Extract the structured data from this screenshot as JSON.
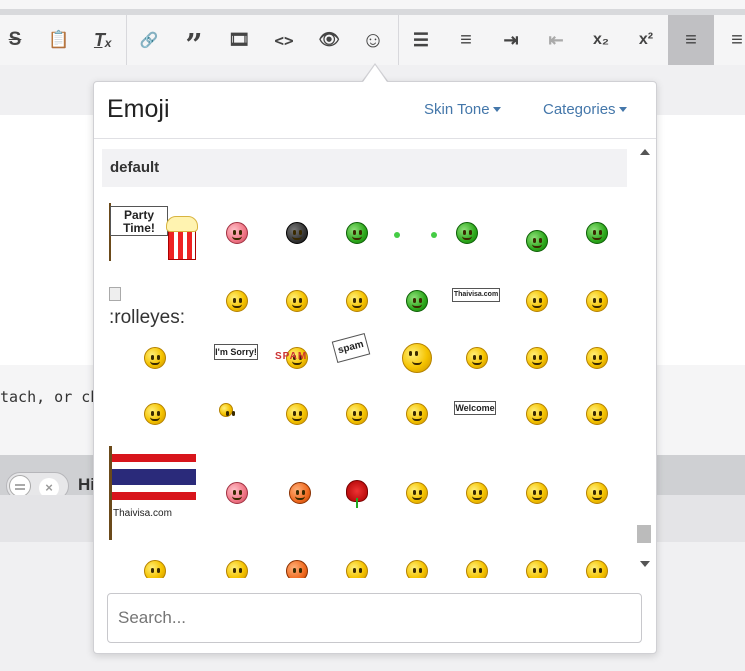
{
  "toolbar": {
    "buttons": [
      {
        "icon": "strikethrough-icon",
        "glyph": "S"
      },
      {
        "icon": "paste-icon",
        "glyph": "📋"
      },
      {
        "icon": "clear-format-icon",
        "glyph": "Tₓ"
      },
      {
        "icon": "link-icon",
        "glyph": "🔗"
      },
      {
        "icon": "quote-icon",
        "glyph": "”"
      },
      {
        "icon": "media-icon",
        "glyph": "🎞"
      },
      {
        "icon": "code-icon",
        "glyph": "<>"
      },
      {
        "icon": "preview-icon",
        "glyph": "👁"
      },
      {
        "icon": "emoji-icon",
        "glyph": "☺"
      },
      {
        "icon": "bullet-list-icon",
        "glyph": "☰"
      },
      {
        "icon": "numbered-list-icon",
        "glyph": "≡"
      },
      {
        "icon": "indent-icon",
        "glyph": "⇥"
      },
      {
        "icon": "outdent-icon",
        "glyph": "⇤"
      },
      {
        "icon": "subscript-icon",
        "glyph": "x₂"
      },
      {
        "icon": "superscript-icon",
        "glyph": "x²"
      },
      {
        "icon": "align-left-icon",
        "glyph": "≡"
      },
      {
        "icon": "align-justify-icon",
        "glyph": "≡"
      }
    ]
  },
  "editor": {
    "hint_text": "tach, or ch",
    "toggle_label": "Hi"
  },
  "emoji_popup": {
    "title": "Emoji",
    "skin_tone_label": "Skin Tone",
    "categories_label": "Categories",
    "section_label": "default",
    "broken_alt": ":rolleyes:",
    "sign_party": "Party Time!",
    "sign_sorry": "I'm Sorry!",
    "sign_spam": "spam",
    "sign_spam2": "SPAM",
    "sign_thaivisa": "Thaivisa.com",
    "sign_welcome": "Welcome",
    "flag_caption": "Thaivisa.com",
    "search_placeholder": "Search..."
  }
}
